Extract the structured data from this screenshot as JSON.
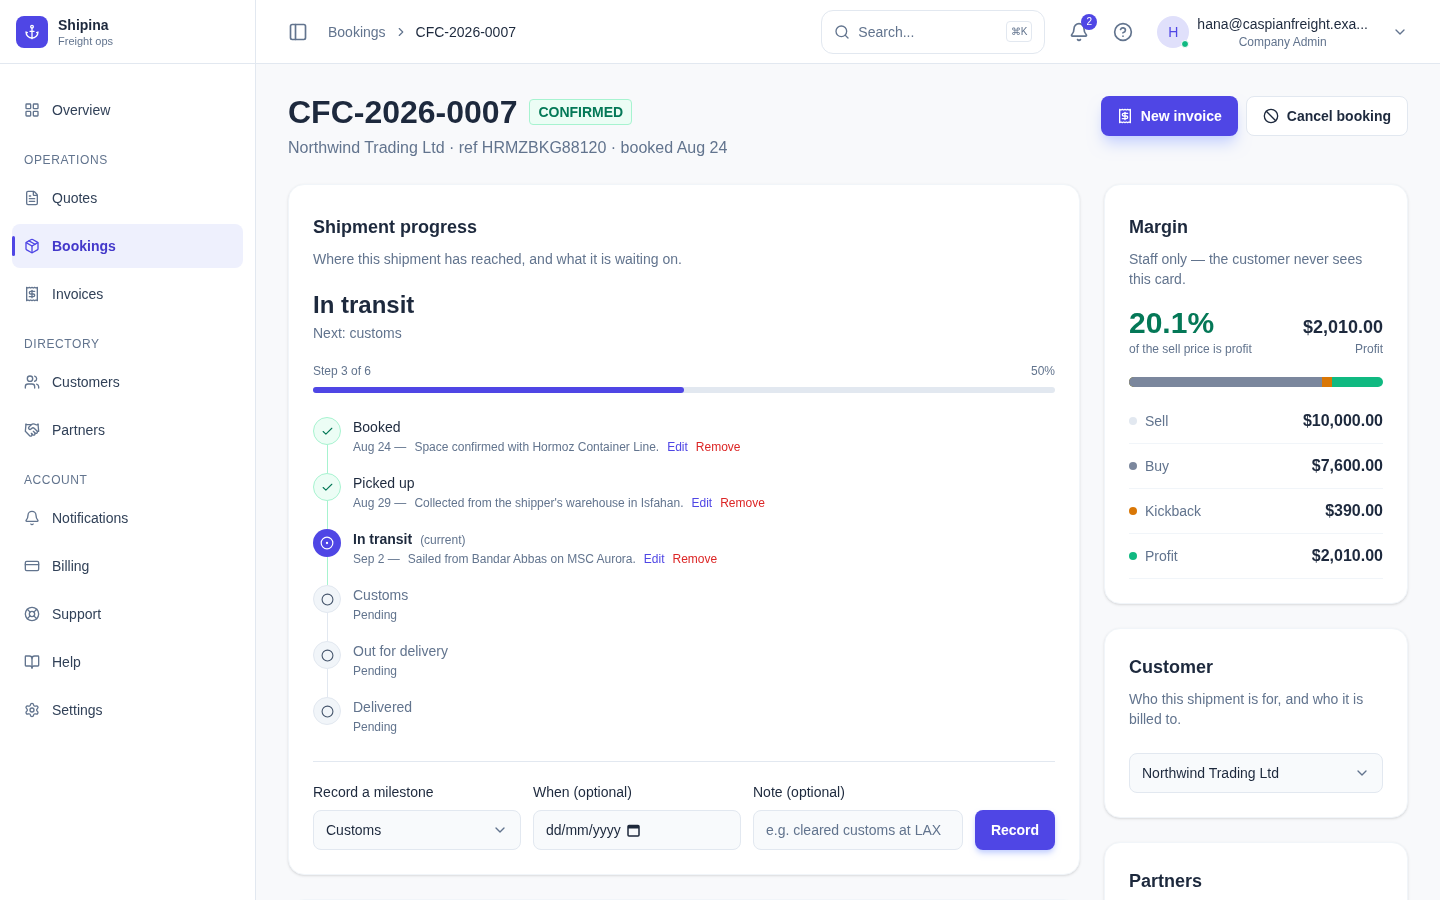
{
  "brand": {
    "name": "Shipina",
    "tagline": "Freight ops"
  },
  "sidebar": {
    "sections": [
      {
        "items": [
          {
            "label": "Overview",
            "selected": false
          }
        ]
      },
      {
        "heading": "OPERATIONS",
        "items": [
          {
            "label": "Quotes",
            "selected": false
          },
          {
            "label": "Bookings",
            "selected": true
          },
          {
            "label": "Invoices",
            "selected": false
          }
        ]
      },
      {
        "heading": "DIRECTORY",
        "items": [
          {
            "label": "Customers",
            "selected": false
          },
          {
            "label": "Partners",
            "selected": false
          }
        ]
      },
      {
        "heading": "ACCOUNT",
        "items": [
          {
            "label": "Notifications",
            "selected": false
          },
          {
            "label": "Billing",
            "selected": false
          },
          {
            "label": "Support",
            "selected": false
          },
          {
            "label": "Help",
            "selected": false
          },
          {
            "label": "Settings",
            "selected": false
          }
        ]
      }
    ]
  },
  "header": {
    "breadcrumb": [
      "Bookings",
      "CFC-2026-0007"
    ],
    "search": {
      "placeholder": "Search...",
      "shortcut": "⌘K"
    },
    "notifications_count": "2",
    "user": {
      "initial": "H",
      "email": "hana@caspianfreight.exa...",
      "role": "Company Admin",
      "online": true
    }
  },
  "booking": {
    "id": "CFC-2026-0007",
    "status": "CONFIRMED",
    "subtitle": "Northwind Trading Ltd · ref HRMZBKG88120 · booked Aug 24",
    "actions": [
      "New invoice",
      "Cancel booking"
    ]
  },
  "progress": {
    "title": "Shipment progress",
    "description": "Where this shipment has reached, and what it is waiting on.",
    "stage": "In transit",
    "next": "Next: customs",
    "step": "Step 3 of 6",
    "percent": "50%",
    "level": 0.5,
    "steps": [
      {
        "kind": "done",
        "title": "Booked",
        "date": "Aug 24 —",
        "note": "Space confirmed with Hormoz Container Line.",
        "edit": "Edit",
        "remove": "Remove"
      },
      {
        "kind": "done",
        "title": "Picked up",
        "date": "Aug 29 —",
        "note": "Collected from the shipper's warehouse in Isfahan.",
        "edit": "Edit",
        "remove": "Remove"
      },
      {
        "kind": "current",
        "title": "In transit",
        "tag": "(current)",
        "date": "Sep 2 —",
        "note": "Sailed from Bandar Abbas on MSC Aurora.",
        "edit": "Edit",
        "remove": "Remove"
      },
      {
        "kind": "pending",
        "title": "Customs",
        "status": "Pending"
      },
      {
        "kind": "pending",
        "title": "Out for delivery",
        "status": "Pending"
      },
      {
        "kind": "pending",
        "title": "Delivered",
        "status": "Pending"
      }
    ],
    "form": {
      "milestone_label": "Record a milestone",
      "milestone_value": "Customs",
      "when_label": "When (optional)",
      "when_value": "dd/mm/yyyy",
      "note_label": "Note (optional)",
      "note_placeholder": "e.g. cleared customs at LAX",
      "submit": "Record"
    }
  },
  "margin": {
    "title": "Margin",
    "description": "Staff only — the customer never sees this card.",
    "percent": "20.1%",
    "percent_caption": "of the sell price is profit",
    "profit": "$2,010.00",
    "profit_label": "Profit",
    "bar": {
      "color": "#10b981",
      "segments": [
        {
          "color": "#7b879d",
          "level": 0.76
        },
        {
          "color": "#d97706",
          "level": 0.799
        }
      ]
    },
    "rows": [
      {
        "label": "Sell",
        "value": "$10,000.00",
        "color": "#e2e8f0"
      },
      {
        "label": "Buy",
        "value": "$7,600.00",
        "color": "#7b879d"
      },
      {
        "label": "Kickback",
        "value": "$390.00",
        "color": "#d97706"
      },
      {
        "label": "Profit",
        "value": "$2,010.00",
        "color": "#10b981"
      }
    ]
  },
  "customer": {
    "title": "Customer",
    "description": "Who this shipment is for, and who it is billed to.",
    "value": "Northwind Trading Ltd"
  },
  "partners": {
    "title": "Partners"
  }
}
